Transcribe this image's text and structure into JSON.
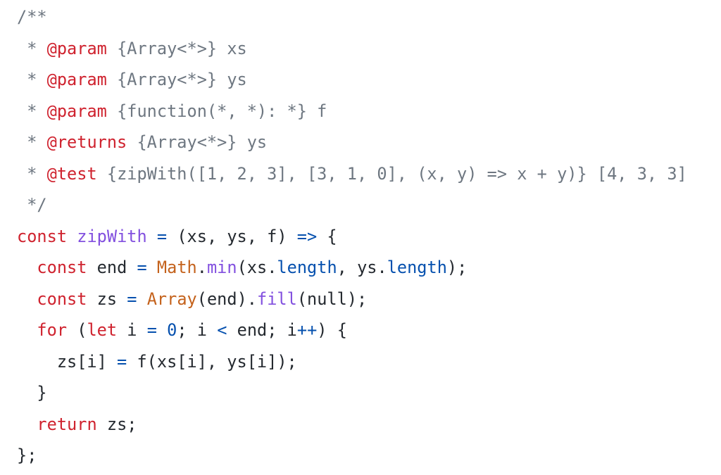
{
  "language": "JavaScript",
  "colors": {
    "background": "#ffffff",
    "comment": "#6e7781",
    "keyword": "#cf222e",
    "function_name": "#8250df",
    "operator_property_number": "#0550ae",
    "builtin": "#c4621c",
    "text": "#24292f"
  },
  "lines": [
    {
      "tokens": [
        {
          "t": "/**",
          "k": "comment"
        }
      ]
    },
    {
      "tokens": [
        {
          "t": " * ",
          "k": "comment"
        },
        {
          "t": "@param",
          "k": "tag"
        },
        {
          "t": " {Array<*>} xs",
          "k": "comment"
        }
      ]
    },
    {
      "tokens": [
        {
          "t": " * ",
          "k": "comment"
        },
        {
          "t": "@param",
          "k": "tag"
        },
        {
          "t": " {Array<*>} ys",
          "k": "comment"
        }
      ]
    },
    {
      "tokens": [
        {
          "t": " * ",
          "k": "comment"
        },
        {
          "t": "@param",
          "k": "tag"
        },
        {
          "t": " {function(*, *): *} f",
          "k": "comment"
        }
      ]
    },
    {
      "tokens": [
        {
          "t": " * ",
          "k": "comment"
        },
        {
          "t": "@returns",
          "k": "tag"
        },
        {
          "t": " {Array<*>} ys",
          "k": "comment"
        }
      ]
    },
    {
      "tokens": [
        {
          "t": " * ",
          "k": "comment"
        },
        {
          "t": "@test",
          "k": "tag"
        },
        {
          "t": " {zipWith([1, 2, 3], [3, 1, 0], (x, y) => x + y)} [4, 3, 3]",
          "k": "comment"
        }
      ]
    },
    {
      "tokens": [
        {
          "t": " */",
          "k": "comment"
        }
      ]
    },
    {
      "tokens": [
        {
          "t": "const",
          "k": "keyword"
        },
        {
          "t": " ",
          "k": "plain"
        },
        {
          "t": "zipWith",
          "k": "fn"
        },
        {
          "t": " ",
          "k": "plain"
        },
        {
          "t": "=",
          "k": "op"
        },
        {
          "t": " (xs, ys, f) ",
          "k": "plain"
        },
        {
          "t": "=>",
          "k": "op"
        },
        {
          "t": " {",
          "k": "plain"
        }
      ]
    },
    {
      "tokens": [
        {
          "t": "  ",
          "k": "plain"
        },
        {
          "t": "const",
          "k": "keyword"
        },
        {
          "t": " end ",
          "k": "plain"
        },
        {
          "t": "=",
          "k": "op"
        },
        {
          "t": " ",
          "k": "plain"
        },
        {
          "t": "Math",
          "k": "builtin"
        },
        {
          "t": ".",
          "k": "plain"
        },
        {
          "t": "min",
          "k": "fn"
        },
        {
          "t": "(xs.",
          "k": "plain"
        },
        {
          "t": "length",
          "k": "prop"
        },
        {
          "t": ", ys.",
          "k": "plain"
        },
        {
          "t": "length",
          "k": "prop"
        },
        {
          "t": ");",
          "k": "plain"
        }
      ]
    },
    {
      "tokens": [
        {
          "t": "  ",
          "k": "plain"
        },
        {
          "t": "const",
          "k": "keyword"
        },
        {
          "t": " zs ",
          "k": "plain"
        },
        {
          "t": "=",
          "k": "op"
        },
        {
          "t": " ",
          "k": "plain"
        },
        {
          "t": "Array",
          "k": "builtin"
        },
        {
          "t": "(end).",
          "k": "plain"
        },
        {
          "t": "fill",
          "k": "fn"
        },
        {
          "t": "(null);",
          "k": "plain"
        }
      ]
    },
    {
      "tokens": [
        {
          "t": "  ",
          "k": "plain"
        },
        {
          "t": "for",
          "k": "keyword"
        },
        {
          "t": " (",
          "k": "plain"
        },
        {
          "t": "let",
          "k": "keyword"
        },
        {
          "t": " i ",
          "k": "plain"
        },
        {
          "t": "=",
          "k": "op"
        },
        {
          "t": " ",
          "k": "plain"
        },
        {
          "t": "0",
          "k": "num"
        },
        {
          "t": "; i ",
          "k": "plain"
        },
        {
          "t": "<",
          "k": "op"
        },
        {
          "t": " end; i",
          "k": "plain"
        },
        {
          "t": "++",
          "k": "op"
        },
        {
          "t": ") {",
          "k": "plain"
        }
      ]
    },
    {
      "tokens": [
        {
          "t": "    zs[i] ",
          "k": "plain"
        },
        {
          "t": "=",
          "k": "op"
        },
        {
          "t": " f(xs[i], ys[i]);",
          "k": "plain"
        }
      ]
    },
    {
      "tokens": [
        {
          "t": "  }",
          "k": "plain"
        }
      ]
    },
    {
      "tokens": [
        {
          "t": "  ",
          "k": "plain"
        },
        {
          "t": "return",
          "k": "keyword"
        },
        {
          "t": " zs;",
          "k": "plain"
        }
      ]
    },
    {
      "tokens": [
        {
          "t": "};",
          "k": "plain"
        }
      ]
    }
  ]
}
